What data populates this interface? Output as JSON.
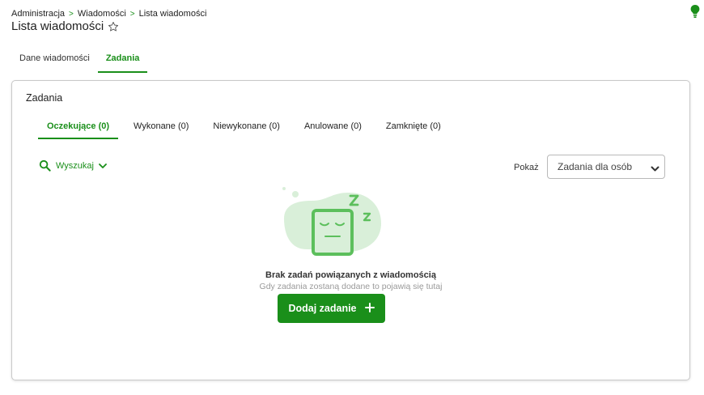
{
  "breadcrumb": {
    "items": [
      "Administracja",
      "Wiadomości",
      "Lista wiadomości"
    ],
    "separator": ">"
  },
  "page": {
    "title": "Lista wiadomości",
    "favorite_icon": "star-outline-icon",
    "help_icon": "lightbulb-icon"
  },
  "top_tabs": [
    {
      "label": "Dane wiadomości",
      "active": false
    },
    {
      "label": "Zadania",
      "active": true
    }
  ],
  "card": {
    "title": "Zadania",
    "sub_tabs": [
      {
        "label": "Oczekujące (0)",
        "active": true
      },
      {
        "label": "Wykonane (0)",
        "active": false
      },
      {
        "label": "Niewykonane (0)",
        "active": false
      },
      {
        "label": "Anulowane (0)",
        "active": false
      },
      {
        "label": "Zamknięte (0)",
        "active": false
      }
    ],
    "search": {
      "label": "Wyszukaj",
      "icon": "search-icon"
    },
    "filter": {
      "label": "Pokaż",
      "selected": "Zadania dla osób"
    },
    "empty_state": {
      "title": "Brak zadań powiązanych z wiadomością",
      "subtitle": "Gdy zadania zostaną dodane to pojawią się tutaj",
      "button_label": "Dodaj zadanie",
      "illustration": "sleeping-box-icon"
    }
  },
  "colors": {
    "accent": "#1a8f1a",
    "illustration_light": "#d9efd9",
    "illustration_mid": "#5cbf5c"
  }
}
